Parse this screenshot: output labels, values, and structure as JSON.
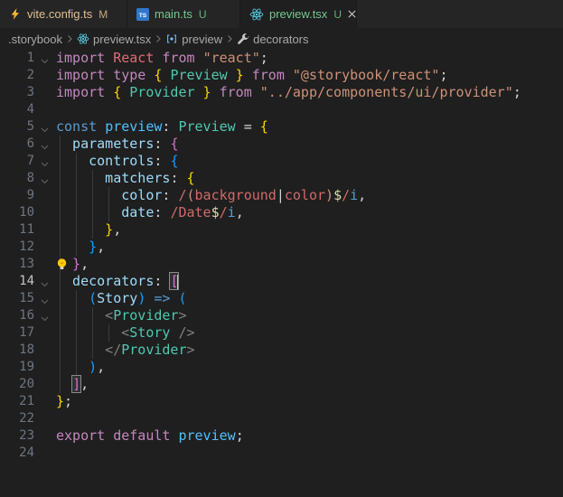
{
  "colors": {
    "editorBg": "#1f1f1f",
    "tabstripBg": "#252526",
    "tabInactiveBg": "#252526",
    "tabActiveBg": "#1f1f1f",
    "tabBorder": "#1a1a1a",
    "gitModified": "#E2C08D",
    "gitUntracked": "#73C991",
    "breadcrumbFg": "#a9a9a9",
    "lineNo": "#6e7681",
    "lineNoActive": "#c6c6c6",
    "indentGuide": "#3b3b3b",
    "cursor": "#cccccc",
    "reactIcon": "#58C4DC",
    "tsIcon": "#3178C6",
    "tok_kw": "#C586C0",
    "tok_ctrl": "#569CD6",
    "tok_red": "#E06C75",
    "tok_teal": "#4EC9B0",
    "tok_blue": "#4FC1FF",
    "tok_prop": "#9CDCFE",
    "tok_str": "#CE9178",
    "tok_rex": "#D16969",
    "tok_rexc": "#DCDCAA",
    "tok_fg": "#D4D4D4",
    "tok_b1": "#FFD700",
    "tok_b2": "#DA70D6",
    "tok_b3": "#179FFF",
    "tok_jsxp": "#808080"
  },
  "tabs": [
    {
      "name": "vite.config.ts",
      "badge": "M",
      "state": "modified",
      "icon": "vite-icon",
      "active": false
    },
    {
      "name": "main.ts",
      "badge": "U",
      "state": "untracked",
      "icon": "typescript-icon",
      "active": false
    },
    {
      "name": "preview.tsx",
      "badge": "U",
      "state": "untracked",
      "icon": "react-icon",
      "active": true
    }
  ],
  "breadcrumbs": [
    {
      "label": ".storybook",
      "icon": null
    },
    {
      "label": "preview.tsx",
      "icon": "react-icon"
    },
    {
      "label": "preview",
      "icon": "symbol-variable-icon"
    },
    {
      "label": "decorators",
      "icon": "symbol-property-icon"
    }
  ],
  "editor": {
    "lines": [
      {
        "n": 1,
        "g": 0,
        "fold": true,
        "t": [
          [
            "kw",
            "import "
          ],
          [
            "red",
            "React"
          ],
          [
            "kw",
            " from "
          ],
          [
            "str",
            "\"react\""
          ],
          [
            "fg",
            ";"
          ]
        ]
      },
      {
        "n": 2,
        "g": 0,
        "t": [
          [
            "kw",
            "import type "
          ],
          [
            "b1",
            "{ "
          ],
          [
            "teal",
            "Preview"
          ],
          [
            "b1",
            " }"
          ],
          [
            "kw",
            " from "
          ],
          [
            "str",
            "\"@storybook/react\""
          ],
          [
            "fg",
            ";"
          ]
        ]
      },
      {
        "n": 3,
        "g": 0,
        "t": [
          [
            "kw",
            "import "
          ],
          [
            "b1",
            "{ "
          ],
          [
            "teal",
            "Provider"
          ],
          [
            "b1",
            " }"
          ],
          [
            "kw",
            " from "
          ],
          [
            "str",
            "\"../app/components/ui/provider\""
          ],
          [
            "fg",
            ";"
          ]
        ]
      },
      {
        "n": 4,
        "g": 0,
        "t": []
      },
      {
        "n": 5,
        "g": 0,
        "fold": true,
        "t": [
          [
            "ctrl",
            "const "
          ],
          [
            "blue",
            "preview"
          ],
          [
            "fg",
            ": "
          ],
          [
            "teal",
            "Preview"
          ],
          [
            "fg",
            " = "
          ],
          [
            "b1",
            "{"
          ]
        ]
      },
      {
        "n": 6,
        "g": 1,
        "fold": true,
        "t": [
          [
            "prop",
            "  parameters"
          ],
          [
            "fg",
            ": "
          ],
          [
            "b2",
            "{"
          ]
        ]
      },
      {
        "n": 7,
        "g": 2,
        "fold": true,
        "t": [
          [
            "prop",
            "    controls"
          ],
          [
            "fg",
            ": "
          ],
          [
            "b3",
            "{"
          ]
        ]
      },
      {
        "n": 8,
        "g": 3,
        "fold": true,
        "t": [
          [
            "prop",
            "      matchers"
          ],
          [
            "fg",
            ": "
          ],
          [
            "b1",
            "{"
          ]
        ]
      },
      {
        "n": 9,
        "g": 4,
        "t": [
          [
            "prop",
            "        color"
          ],
          [
            "fg",
            ": "
          ],
          [
            "rex",
            "/"
          ],
          [
            "str",
            "("
          ],
          [
            "rex",
            "background"
          ],
          [
            "fg",
            "|"
          ],
          [
            "rex",
            "color"
          ],
          [
            "str",
            ")"
          ],
          [
            "rexc",
            "$"
          ],
          [
            "rex",
            "/"
          ],
          [
            "ctrl",
            "i"
          ],
          [
            "fg",
            ","
          ]
        ]
      },
      {
        "n": 10,
        "g": 4,
        "t": [
          [
            "prop",
            "        date"
          ],
          [
            "fg",
            ": "
          ],
          [
            "rex",
            "/Date"
          ],
          [
            "rexc",
            "$"
          ],
          [
            "rex",
            "/"
          ],
          [
            "ctrl",
            "i"
          ],
          [
            "fg",
            ","
          ]
        ]
      },
      {
        "n": 11,
        "g": 3,
        "t": [
          [
            "b1",
            "      }"
          ],
          [
            "fg",
            ","
          ]
        ]
      },
      {
        "n": 12,
        "g": 2,
        "t": [
          [
            "b3",
            "    }"
          ],
          [
            "fg",
            ","
          ]
        ]
      },
      {
        "n": 13,
        "g": 1,
        "bulb": true,
        "t": [
          [
            "b2",
            "  }"
          ],
          [
            "fg",
            ","
          ]
        ]
      },
      {
        "n": 14,
        "g": 1,
        "fold": true,
        "active": true,
        "t": [
          [
            "prop",
            "  decorators"
          ],
          [
            "fg",
            ": "
          ],
          [
            "b2",
            "[",
            "match"
          ],
          [
            "cur",
            ""
          ]
        ]
      },
      {
        "n": 15,
        "g": 2,
        "fold": true,
        "t": [
          [
            "b3",
            "    ("
          ],
          [
            "prop",
            "Story"
          ],
          [
            "b3",
            ")"
          ],
          [
            "ctrl",
            " => "
          ],
          [
            "b3",
            "("
          ]
        ]
      },
      {
        "n": 16,
        "g": 3,
        "fold": true,
        "t": [
          [
            "jsxp",
            "      <"
          ],
          [
            "teal",
            "Provider"
          ],
          [
            "jsxp",
            ">"
          ]
        ]
      },
      {
        "n": 17,
        "g": 4,
        "t": [
          [
            "jsxp",
            "        <"
          ],
          [
            "teal",
            "Story"
          ],
          [
            "jsxp",
            " />"
          ]
        ]
      },
      {
        "n": 18,
        "g": 3,
        "t": [
          [
            "jsxp",
            "      </"
          ],
          [
            "teal",
            "Provider"
          ],
          [
            "jsxp",
            ">"
          ]
        ]
      },
      {
        "n": 19,
        "g": 2,
        "t": [
          [
            "b3",
            "    )"
          ],
          [
            "fg",
            ","
          ]
        ]
      },
      {
        "n": 20,
        "g": 1,
        "t": [
          [
            "fg",
            "  "
          ],
          [
            "b2",
            "]",
            "match"
          ],
          [
            "fg",
            ","
          ]
        ]
      },
      {
        "n": 21,
        "g": 0,
        "t": [
          [
            "b1",
            "}"
          ],
          [
            "fg",
            ";"
          ]
        ]
      },
      {
        "n": 22,
        "g": 0,
        "t": []
      },
      {
        "n": 23,
        "g": 0,
        "t": [
          [
            "kw",
            "export default "
          ],
          [
            "blue",
            "preview"
          ],
          [
            "fg",
            ";"
          ]
        ]
      },
      {
        "n": 24,
        "g": 0,
        "t": []
      }
    ]
  }
}
